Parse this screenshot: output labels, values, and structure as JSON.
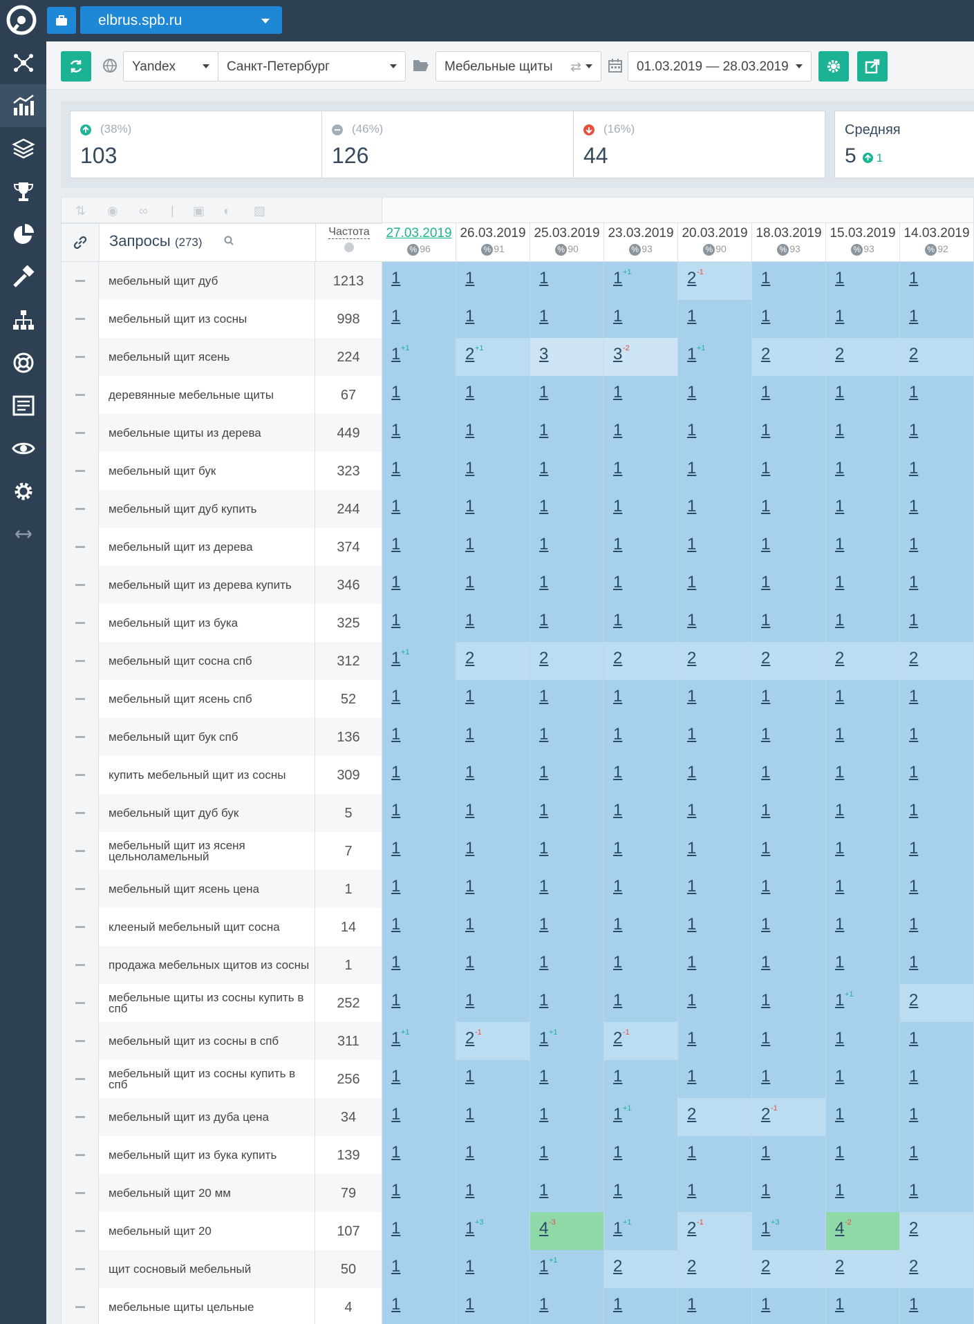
{
  "site": {
    "name": "elbrus.spb.ru"
  },
  "toolbar": {
    "engine": "Yandex",
    "region": "Санкт-Петербург",
    "group": "Мебельные щиты",
    "date_range": "01.03.2019 — 28.03.2019"
  },
  "stats": {
    "up": {
      "pct": "(38%)",
      "count": "103"
    },
    "same": {
      "pct": "(46%)",
      "count": "126"
    },
    "down": {
      "pct": "(16%)",
      "count": "44"
    },
    "avg": {
      "title": "Средняя",
      "value": "5",
      "delta": "1"
    }
  },
  "colors": {
    "green": "#1bb394",
    "blue": "#1e88d6",
    "sidebar": "#2e4053",
    "cell": "#a6d0ec",
    "cell_light": "#bcdcf1",
    "cell_top": "#8fd9a8",
    "up": "#1bb394",
    "down": "#e74c3c"
  },
  "table": {
    "title": "Запросы",
    "count": "(273)",
    "freq_label": "Частота",
    "dates": [
      {
        "date": "27.03.2019",
        "vis": "96",
        "active": true
      },
      {
        "date": "26.03.2019",
        "vis": "91"
      },
      {
        "date": "25.03.2019",
        "vis": "90"
      },
      {
        "date": "23.03.2019",
        "vis": "93"
      },
      {
        "date": "20.03.2019",
        "vis": "90"
      },
      {
        "date": "18.03.2019",
        "vis": "93"
      },
      {
        "date": "15.03.2019",
        "vis": "93"
      },
      {
        "date": "14.03.2019",
        "vis": "92"
      }
    ],
    "rows": [
      {
        "q": "мебельный щит дуб",
        "f": "1213",
        "p": [
          [
            "1"
          ],
          [
            "1"
          ],
          [
            "1"
          ],
          [
            "1",
            "+1"
          ],
          [
            "2",
            "-1"
          ],
          [
            "1"
          ],
          [
            "1"
          ],
          [
            "1"
          ]
        ]
      },
      {
        "q": "мебельный щит из сосны",
        "f": "998",
        "p": [
          [
            "1"
          ],
          [
            "1"
          ],
          [
            "1"
          ],
          [
            "1"
          ],
          [
            "1"
          ],
          [
            "1"
          ],
          [
            "1"
          ],
          [
            "1"
          ]
        ]
      },
      {
        "q": "мебельный щит ясень",
        "f": "224",
        "p": [
          [
            "1",
            "+1"
          ],
          [
            "2",
            "+1"
          ],
          [
            "3"
          ],
          [
            "3",
            "-2"
          ],
          [
            "1",
            "+1"
          ],
          [
            "2"
          ],
          [
            "2"
          ],
          [
            "2"
          ]
        ]
      },
      {
        "q": "деревянные мебельные щиты",
        "f": "67",
        "p": [
          [
            "1"
          ],
          [
            "1"
          ],
          [
            "1"
          ],
          [
            "1"
          ],
          [
            "1"
          ],
          [
            "1"
          ],
          [
            "1"
          ],
          [
            "1"
          ]
        ]
      },
      {
        "q": "мебельные щиты из дерева",
        "f": "449",
        "p": [
          [
            "1"
          ],
          [
            "1"
          ],
          [
            "1"
          ],
          [
            "1"
          ],
          [
            "1"
          ],
          [
            "1"
          ],
          [
            "1"
          ],
          [
            "1"
          ]
        ]
      },
      {
        "q": "мебельный щит бук",
        "f": "323",
        "p": [
          [
            "1"
          ],
          [
            "1"
          ],
          [
            "1"
          ],
          [
            "1"
          ],
          [
            "1"
          ],
          [
            "1"
          ],
          [
            "1"
          ],
          [
            "1"
          ]
        ]
      },
      {
        "q": "мебельный щит дуб купить",
        "f": "244",
        "p": [
          [
            "1"
          ],
          [
            "1"
          ],
          [
            "1"
          ],
          [
            "1"
          ],
          [
            "1"
          ],
          [
            "1"
          ],
          [
            "1"
          ],
          [
            "1"
          ]
        ]
      },
      {
        "q": "мебельный щит из дерева",
        "f": "374",
        "p": [
          [
            "1"
          ],
          [
            "1"
          ],
          [
            "1"
          ],
          [
            "1"
          ],
          [
            "1"
          ],
          [
            "1"
          ],
          [
            "1"
          ],
          [
            "1"
          ]
        ]
      },
      {
        "q": "мебельный щит из дерева купить",
        "f": "346",
        "p": [
          [
            "1"
          ],
          [
            "1"
          ],
          [
            "1"
          ],
          [
            "1"
          ],
          [
            "1"
          ],
          [
            "1"
          ],
          [
            "1"
          ],
          [
            "1"
          ]
        ]
      },
      {
        "q": "мебельный щит из бука",
        "f": "325",
        "p": [
          [
            "1"
          ],
          [
            "1"
          ],
          [
            "1"
          ],
          [
            "1"
          ],
          [
            "1"
          ],
          [
            "1"
          ],
          [
            "1"
          ],
          [
            "1"
          ]
        ]
      },
      {
        "q": "мебельный щит сосна спб",
        "f": "312",
        "p": [
          [
            "1",
            "+1"
          ],
          [
            "2"
          ],
          [
            "2"
          ],
          [
            "2"
          ],
          [
            "2"
          ],
          [
            "2"
          ],
          [
            "2"
          ],
          [
            "2"
          ]
        ]
      },
      {
        "q": "мебельный щит ясень спб",
        "f": "52",
        "p": [
          [
            "1"
          ],
          [
            "1"
          ],
          [
            "1"
          ],
          [
            "1"
          ],
          [
            "1"
          ],
          [
            "1"
          ],
          [
            "1"
          ],
          [
            "1"
          ]
        ]
      },
      {
        "q": "мебельный щит бук спб",
        "f": "136",
        "p": [
          [
            "1"
          ],
          [
            "1"
          ],
          [
            "1"
          ],
          [
            "1"
          ],
          [
            "1"
          ],
          [
            "1"
          ],
          [
            "1"
          ],
          [
            "1"
          ]
        ]
      },
      {
        "q": "купить мебельный щит из сосны",
        "f": "309",
        "p": [
          [
            "1"
          ],
          [
            "1"
          ],
          [
            "1"
          ],
          [
            "1"
          ],
          [
            "1"
          ],
          [
            "1"
          ],
          [
            "1"
          ],
          [
            "1"
          ]
        ]
      },
      {
        "q": "мебельный щит дуб бук",
        "f": "5",
        "p": [
          [
            "1"
          ],
          [
            "1"
          ],
          [
            "1"
          ],
          [
            "1"
          ],
          [
            "1"
          ],
          [
            "1"
          ],
          [
            "1"
          ],
          [
            "1"
          ]
        ]
      },
      {
        "q": "мебельный щит из ясеня цельноламельный",
        "f": "7",
        "p": [
          [
            "1"
          ],
          [
            "1"
          ],
          [
            "1"
          ],
          [
            "1"
          ],
          [
            "1"
          ],
          [
            "1"
          ],
          [
            "1"
          ],
          [
            "1"
          ]
        ]
      },
      {
        "q": "мебельный щит ясень цена",
        "f": "1",
        "p": [
          [
            "1"
          ],
          [
            "1"
          ],
          [
            "1"
          ],
          [
            "1"
          ],
          [
            "1"
          ],
          [
            "1"
          ],
          [
            "1"
          ],
          [
            "1"
          ]
        ]
      },
      {
        "q": "клееный мебельный щит сосна",
        "f": "14",
        "p": [
          [
            "1"
          ],
          [
            "1"
          ],
          [
            "1"
          ],
          [
            "1"
          ],
          [
            "1"
          ],
          [
            "1"
          ],
          [
            "1"
          ],
          [
            "1"
          ]
        ]
      },
      {
        "q": "продажа мебельных щитов из сосны",
        "f": "1",
        "p": [
          [
            "1"
          ],
          [
            "1"
          ],
          [
            "1"
          ],
          [
            "1"
          ],
          [
            "1"
          ],
          [
            "1"
          ],
          [
            "1"
          ],
          [
            "1"
          ]
        ]
      },
      {
        "q": "мебельные щиты из сосны купить в спб",
        "f": "252",
        "p": [
          [
            "1"
          ],
          [
            "1"
          ],
          [
            "1"
          ],
          [
            "1"
          ],
          [
            "1"
          ],
          [
            "1"
          ],
          [
            "1",
            "+1"
          ],
          [
            "2"
          ]
        ]
      },
      {
        "q": "мебельный щит из сосны в спб",
        "f": "311",
        "p": [
          [
            "1",
            "+1"
          ],
          [
            "2",
            "-1"
          ],
          [
            "1",
            "+1"
          ],
          [
            "2",
            "-1"
          ],
          [
            "1"
          ],
          [
            "1"
          ],
          [
            "1"
          ],
          [
            "1"
          ]
        ]
      },
      {
        "q": "мебельный щит из сосны купить в спб",
        "f": "256",
        "p": [
          [
            "1"
          ],
          [
            "1"
          ],
          [
            "1"
          ],
          [
            "1"
          ],
          [
            "1"
          ],
          [
            "1"
          ],
          [
            "1"
          ],
          [
            "1"
          ]
        ]
      },
      {
        "q": "мебельный щит из дуба цена",
        "f": "34",
        "p": [
          [
            "1"
          ],
          [
            "1"
          ],
          [
            "1"
          ],
          [
            "1",
            "+1"
          ],
          [
            "2"
          ],
          [
            "2",
            "-1"
          ],
          [
            "1"
          ],
          [
            "1"
          ]
        ]
      },
      {
        "q": "мебельный щит из бука купить",
        "f": "139",
        "p": [
          [
            "1"
          ],
          [
            "1"
          ],
          [
            "1"
          ],
          [
            "1"
          ],
          [
            "1"
          ],
          [
            "1"
          ],
          [
            "1"
          ],
          [
            "1"
          ]
        ]
      },
      {
        "q": "мебельный щит 20 мм",
        "f": "79",
        "p": [
          [
            "1"
          ],
          [
            "1"
          ],
          [
            "1"
          ],
          [
            "1"
          ],
          [
            "1"
          ],
          [
            "1"
          ],
          [
            "1"
          ],
          [
            "1"
          ]
        ]
      },
      {
        "q": "мебельный щит 20",
        "f": "107",
        "p": [
          [
            "1"
          ],
          [
            "1",
            "+3"
          ],
          [
            "4",
            "-3"
          ],
          [
            "1",
            "+1"
          ],
          [
            "2",
            "-1"
          ],
          [
            "1",
            "+3"
          ],
          [
            "4",
            "-2"
          ],
          [
            "2"
          ]
        ]
      },
      {
        "q": "щит сосновый мебельный",
        "f": "50",
        "p": [
          [
            "1"
          ],
          [
            "1"
          ],
          [
            "1",
            "+1"
          ],
          [
            "2"
          ],
          [
            "2"
          ],
          [
            "2"
          ],
          [
            "2"
          ],
          [
            "2"
          ]
        ]
      },
      {
        "q": "мебельные щиты цельные",
        "f": "4",
        "p": [
          [
            "1"
          ],
          [
            "1"
          ],
          [
            "1"
          ],
          [
            "1"
          ],
          [
            "1"
          ],
          [
            "1"
          ],
          [
            "1"
          ],
          [
            "1"
          ]
        ]
      }
    ]
  }
}
